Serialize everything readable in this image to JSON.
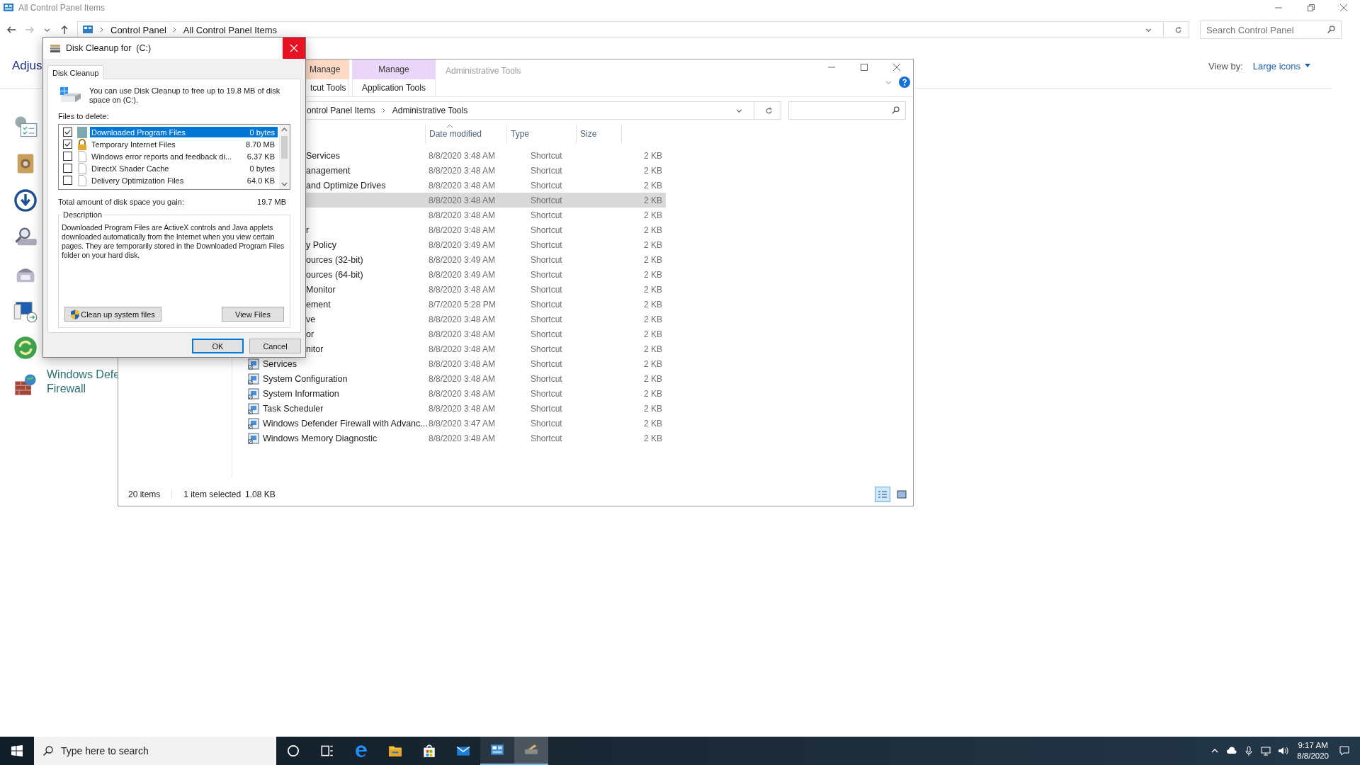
{
  "control_panel": {
    "title": "All Control Panel Items",
    "breadcrumb": [
      "Control Panel",
      "All Control Panel Items"
    ],
    "search": {
      "placeholder": "Search Control Panel"
    },
    "heading": "Adjus",
    "view_by_label": "View by:",
    "view_by_value": "Large icons",
    "firewall_label": [
      "Windows Defe",
      "Firewall"
    ]
  },
  "explorer": {
    "title": "Administrative Tools",
    "ribbon_tabs": [
      {
        "label": "Manage",
        "sub": "tcut Tools",
        "color": "#fcd9c4"
      },
      {
        "label": "Manage",
        "sub": "Application Tools",
        "color": "#ead6f8"
      }
    ],
    "breadcrumb": [
      "ontrol Panel Items",
      "Administrative Tools"
    ],
    "columns": [
      "Date modified",
      "Type",
      "Size"
    ],
    "rows": [
      {
        "name": "Services",
        "clipped": true,
        "date": "8/8/2020 3:48 AM",
        "type": "Shortcut",
        "size": "2 KB",
        "selected": false
      },
      {
        "name": "anagement",
        "clipped": true,
        "date": "8/8/2020 3:48 AM",
        "type": "Shortcut",
        "size": "2 KB",
        "selected": false
      },
      {
        "name": "and Optimize Drives",
        "clipped": true,
        "date": "8/8/2020 3:48 AM",
        "type": "Shortcut",
        "size": "2 KB",
        "selected": false
      },
      {
        "date": "8/8/2020 3:48 AM",
        "type": "Shortcut",
        "size": "2 KB",
        "selected": true
      },
      {
        "date": "8/8/2020 3:48 AM",
        "type": "Shortcut",
        "size": "2 KB",
        "selected": false
      },
      {
        "name": "r",
        "clipped": true,
        "date": "8/8/2020 3:48 AM",
        "type": "Shortcut",
        "size": "2 KB",
        "selected": false
      },
      {
        "name": "y Policy",
        "clipped": true,
        "date": "8/8/2020 3:49 AM",
        "type": "Shortcut",
        "size": "2 KB",
        "selected": false
      },
      {
        "name": "ources (32-bit)",
        "clipped": true,
        "date": "8/8/2020 3:49 AM",
        "type": "Shortcut",
        "size": "2 KB",
        "selected": false
      },
      {
        "name": "ources (64-bit)",
        "clipped": true,
        "date": "8/8/2020 3:49 AM",
        "type": "Shortcut",
        "size": "2 KB",
        "selected": false
      },
      {
        "name": "Monitor",
        "clipped": true,
        "date": "8/8/2020 3:48 AM",
        "type": "Shortcut",
        "size": "2 KB",
        "selected": false
      },
      {
        "name": "ement",
        "clipped": true,
        "date": "8/7/2020 5:28 PM",
        "type": "Shortcut",
        "size": "2 KB",
        "selected": false
      },
      {
        "name": "ve",
        "clipped": true,
        "date": "8/8/2020 3:48 AM",
        "type": "Shortcut",
        "size": "2 KB",
        "selected": false
      },
      {
        "name": "or",
        "clipped": true,
        "date": "8/8/2020 3:48 AM",
        "type": "Shortcut",
        "size": "2 KB",
        "selected": false
      },
      {
        "name": "nitor",
        "clipped": true,
        "date": "8/8/2020 3:48 AM",
        "type": "Shortcut",
        "size": "2 KB",
        "selected": false
      },
      {
        "name": "Services",
        "clipped": false,
        "date": "8/8/2020 3:48 AM",
        "type": "Shortcut",
        "size": "2 KB",
        "selected": false
      },
      {
        "name": "System Configuration",
        "clipped": false,
        "date": "8/8/2020 3:48 AM",
        "type": "Shortcut",
        "size": "2 KB",
        "selected": false
      },
      {
        "name": "System Information",
        "clipped": false,
        "date": "8/8/2020 3:48 AM",
        "type": "Shortcut",
        "size": "2 KB",
        "selected": false
      },
      {
        "name": "Task Scheduler",
        "clipped": false,
        "date": "8/8/2020 3:48 AM",
        "type": "Shortcut",
        "size": "2 KB",
        "selected": false
      },
      {
        "name": "Windows Defender Firewall with Advanc...",
        "clipped": false,
        "date": "8/8/2020 3:47 AM",
        "type": "Shortcut",
        "size": "2 KB",
        "selected": false
      },
      {
        "name": "Windows Memory Diagnostic",
        "clipped": false,
        "date": "8/8/2020 3:48 AM",
        "type": "Shortcut",
        "size": "2 KB",
        "selected": false
      }
    ],
    "status": [
      "20 items",
      "1 item selected",
      "1.08 KB"
    ]
  },
  "dialog": {
    "title": "Disk Cleanup for  (C:)",
    "tab": "Disk Cleanup",
    "intro": "You can use Disk Cleanup to free up to 19.8 MB of disk space on  (C:).",
    "files_label": "Files to delete:",
    "files": [
      {
        "kind": "program",
        "name": "Downloaded Program Files",
        "size": "0 bytes",
        "checked": true,
        "selected": true
      },
      {
        "kind": "lock",
        "name": "Temporary Internet Files",
        "size": "8.70 MB",
        "checked": true,
        "selected": false
      },
      {
        "kind": "page",
        "name": "Windows error reports and feedback di...",
        "size": "6.37 KB",
        "checked": false,
        "selected": false
      },
      {
        "kind": "page",
        "name": "DirectX Shader Cache",
        "size": "0 bytes",
        "checked": false,
        "selected": false
      },
      {
        "kind": "page",
        "name": "Delivery Optimization Files",
        "size": "64.0 KB",
        "checked": false,
        "selected": false
      }
    ],
    "total_label": "Total amount of disk space you gain:",
    "total_value": "19.7 MB",
    "description_label": "Description",
    "description": "Downloaded Program Files are ActiveX controls and Java applets downloaded automatically from the Internet when you view certain pages. They are temporarily stored in the Downloaded Program Files folder on your hard disk.",
    "cleanup_button": "Clean up system files",
    "view_button": "View Files",
    "ok_button": "OK",
    "cancel_button": "Cancel"
  },
  "taskbar": {
    "search": {
      "placeholder": "Type here to search"
    },
    "apps": [
      {
        "kind": "cortana",
        "selected": false
      },
      {
        "kind": "taskview",
        "selected": false
      },
      {
        "kind": "edge",
        "selected": false
      },
      {
        "kind": "folder",
        "selected": false
      },
      {
        "kind": "store",
        "selected": false
      },
      {
        "kind": "mail",
        "selected": false
      },
      {
        "kind": "control",
        "selected": false
      },
      {
        "kind": "cleanup",
        "selected": true
      }
    ],
    "time": "9:17 AM",
    "date": "8/8/2020"
  }
}
